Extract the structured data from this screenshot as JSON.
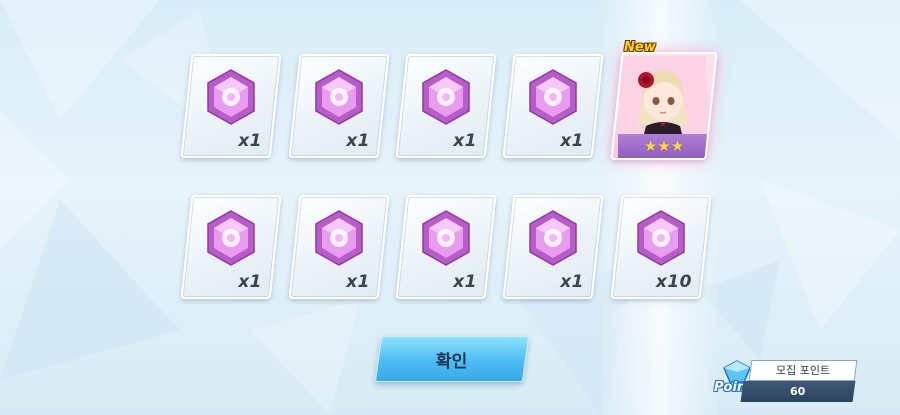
{
  "rewards": {
    "row1": [
      {
        "item": "gem-crystal",
        "quantity": "x1"
      },
      {
        "item": "gem-crystal",
        "quantity": "x1"
      },
      {
        "item": "gem-crystal",
        "quantity": "x1"
      },
      {
        "item": "gem-crystal",
        "quantity": "x1"
      }
    ],
    "row2": [
      {
        "item": "gem-crystal",
        "quantity": "x1"
      },
      {
        "item": "gem-crystal",
        "quantity": "x1"
      },
      {
        "item": "gem-crystal",
        "quantity": "x1"
      },
      {
        "item": "gem-crystal",
        "quantity": "x1"
      },
      {
        "item": "gem-crystal",
        "quantity": "x10"
      }
    ],
    "character": {
      "badge": "New",
      "stars": "★★★",
      "rarity": 3
    }
  },
  "confirm_button": {
    "label": "확인"
  },
  "points": {
    "icon_label": "Point",
    "title": "모집 포인트",
    "value": "60"
  },
  "colors": {
    "accent_blue": "#4cbcf4",
    "gem_pink": "#d35bd8",
    "star_gold": "#ffd64a",
    "panel_dark": "#2c4460"
  }
}
